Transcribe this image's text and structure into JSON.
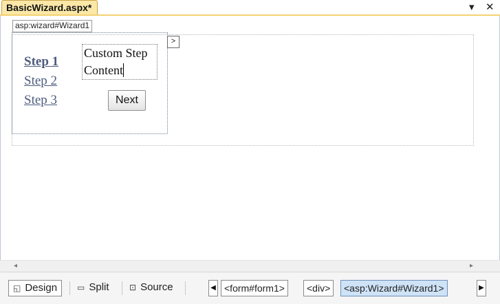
{
  "document_tab": {
    "title": "BasicWizard.aspx*"
  },
  "tab_controls": {
    "dropdown_icon": "chevron-down-icon",
    "close_icon": "close-icon"
  },
  "designer": {
    "control_tag": "asp:wizard#Wizard1",
    "smart_tag_glyph": ">",
    "wizard": {
      "steps": [
        "Step 1",
        "Step 2",
        "Step 3"
      ],
      "active_step": "Step 1",
      "content_lines": [
        "Custom Step",
        "Content"
      ],
      "next_label": "Next"
    }
  },
  "view_buttons": [
    {
      "label": "Design",
      "icon": "design-view-icon",
      "active": true
    },
    {
      "label": "Split",
      "icon": "split-view-icon",
      "active": false
    },
    {
      "label": "Source",
      "icon": "source-view-icon",
      "active": false
    }
  ],
  "breadcrumb": [
    "<form#form1>",
    "<div>",
    "<asp:Wizard#Wizard1>"
  ],
  "colors": {
    "tab_background": "#fbe8a7",
    "active_crumb": "#cfe3f7",
    "step_link": "#4d5b7c"
  }
}
